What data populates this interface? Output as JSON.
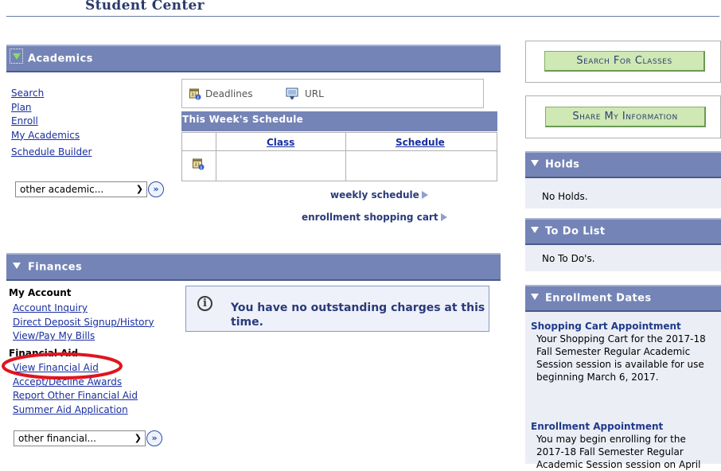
{
  "header": {
    "title": "Student Center"
  },
  "academics": {
    "title": "Academics",
    "links": [
      "Search",
      "Plan",
      "Enroll",
      "My Academics"
    ],
    "schedule_builder": "Schedule Builder",
    "dropdown": "other academic...",
    "tabs": {
      "deadlines": "Deadlines",
      "url": "URL"
    },
    "schedule": {
      "title": "This Week's Schedule",
      "col_class": "Class",
      "col_schedule": "Schedule"
    },
    "weekly_schedule": "weekly schedule",
    "shopping_cart": "enrollment shopping cart"
  },
  "finances": {
    "title": "Finances",
    "my_account": "My Account",
    "account_links": [
      "Account Inquiry",
      "Direct Deposit Signup/History",
      "View/Pay My Bills"
    ],
    "financial_aid": "Financial Aid",
    "aid_links": [
      "View Financial Aid",
      "Accept/Decline Awards",
      "Report Other Financial Aid",
      "Summer Aid Application"
    ],
    "dropdown": "other financial...",
    "message": "You have no outstanding charges at this time."
  },
  "right": {
    "search_button": "Search For Classes",
    "share_button": "Share My Information",
    "holds": {
      "title": "Holds",
      "text": "No Holds."
    },
    "todo": {
      "title": "To Do List",
      "text": "No To Do's."
    },
    "enrollment": {
      "title": "Enrollment Dates",
      "cart_title": "Shopping Cart Appointment",
      "cart_text": "Your Shopping Cart for the 2017-18 Fall Semester Regular Academic Session session is available for use beginning March 6, 2017.",
      "appt_title": "Enrollment Appointment",
      "appt_text": "You may begin enrolling for the 2017-18 Fall Semester Regular Academic Session session on April"
    }
  },
  "colors": {
    "header_bar": "#7484b6",
    "link": "#1a2fa0",
    "highlight_circle": "#e0141e",
    "button_green": "#cfe8b4"
  }
}
